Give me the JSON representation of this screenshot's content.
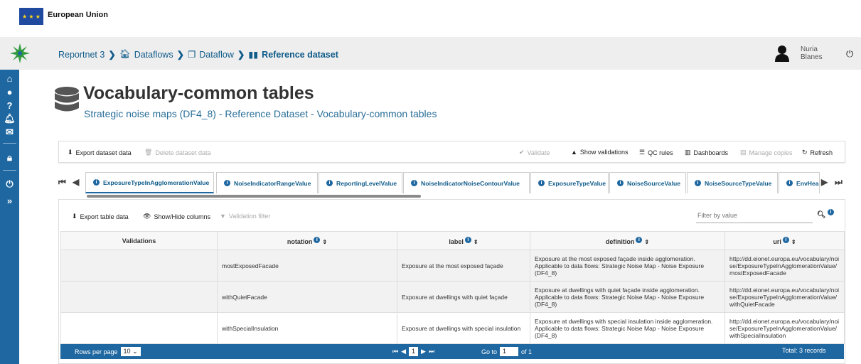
{
  "header": {
    "org": "European Union"
  },
  "breadcrumb": {
    "items": [
      {
        "label": "Reportnet 3"
      },
      {
        "label": "Dataflows"
      },
      {
        "label": "Dataflow"
      },
      {
        "label": "Reference dataset"
      }
    ]
  },
  "user": {
    "first": "Nuria",
    "last": "Blanes"
  },
  "page": {
    "title": "Vocabulary-common tables",
    "subtitle": "Strategic noise maps (DF4_8) - Reference Dataset - Vocabulary-common tables"
  },
  "toolbar": {
    "export_label": "Export dataset data",
    "delete_label": "Delete dataset data",
    "validate_label": "Validate",
    "show_validations_label": "Show validations",
    "qc_rules_label": "QC rules",
    "dashboards_label": "Dashboards",
    "manage_copies_label": "Manage copies",
    "refresh_label": "Refresh"
  },
  "tabs": [
    {
      "label": "ExposureTypeInAgglomerationValue",
      "active": true
    },
    {
      "label": "NoiseIndicatorRangeValue"
    },
    {
      "label": "ReportingLevelValue"
    },
    {
      "label": "NoiseIndicatorNoiseContourValue"
    },
    {
      "label": "ExposureTypeValue"
    },
    {
      "label": "NoiseSourceValue"
    },
    {
      "label": "NoiseSourceTypeValue"
    },
    {
      "label": "EnvHea"
    }
  ],
  "table_toolbar": {
    "export_label": "Export table data",
    "show_hide_label": "Show/Hide columns",
    "validation_filter_label": "Validation filter",
    "filter_placeholder": "Filter by value"
  },
  "table": {
    "columns": [
      "Validations",
      "notation",
      "label",
      "definition",
      "uri"
    ],
    "rows": [
      {
        "validations": "",
        "notation": "mostExposedFacade",
        "label": "Exposure at the most exposed façade",
        "definition": "Exposure at the most exposed façade inside agglomeration. Applicable to data flows: Strategic Noise Map - Noise Exposure (DF4_8)",
        "uri": "http://dd.eionet.europa.eu/vocabulary/noise/ExposureTypeInAgglomerationValue/mostExposedFacade"
      },
      {
        "validations": "",
        "notation": "withQuietFacade",
        "label": "Exposure at dwellings with quiet façade",
        "definition": "Exposure at dwellings with quiet façade inside agglomeration. Applicable to data flows: Strategic Noise Map - Noise Exposure (DF4_8)",
        "uri": "http://dd.eionet.europa.eu/vocabulary/noise/ExposureTypeInAgglomerationValue/withQuietFacade"
      },
      {
        "validations": "",
        "notation": "withSpecialInsulation",
        "label": "Exposure at dwellings with special insulation",
        "definition": "Exposure at dwellings with special insulation inside agglomeration. Applicable to data flows: Strategic Noise Map - Noise Exposure (DF4_8)",
        "uri": "http://dd.eionet.europa.eu/vocabulary/noise/ExposureTypeInAgglomerationValue/withSpecialInsulation"
      }
    ]
  },
  "paginator": {
    "rows_per_page_label": "Rows per page",
    "rows_per_page": "10",
    "current_page": "1",
    "goto_label": "Go to",
    "goto_value": "1",
    "of_label": "of 1",
    "total_label": "Total: 3 records"
  },
  "colors": {
    "primary": "#1e67a1",
    "navbar": "#eeeeee",
    "link": "#0f5b8a"
  }
}
